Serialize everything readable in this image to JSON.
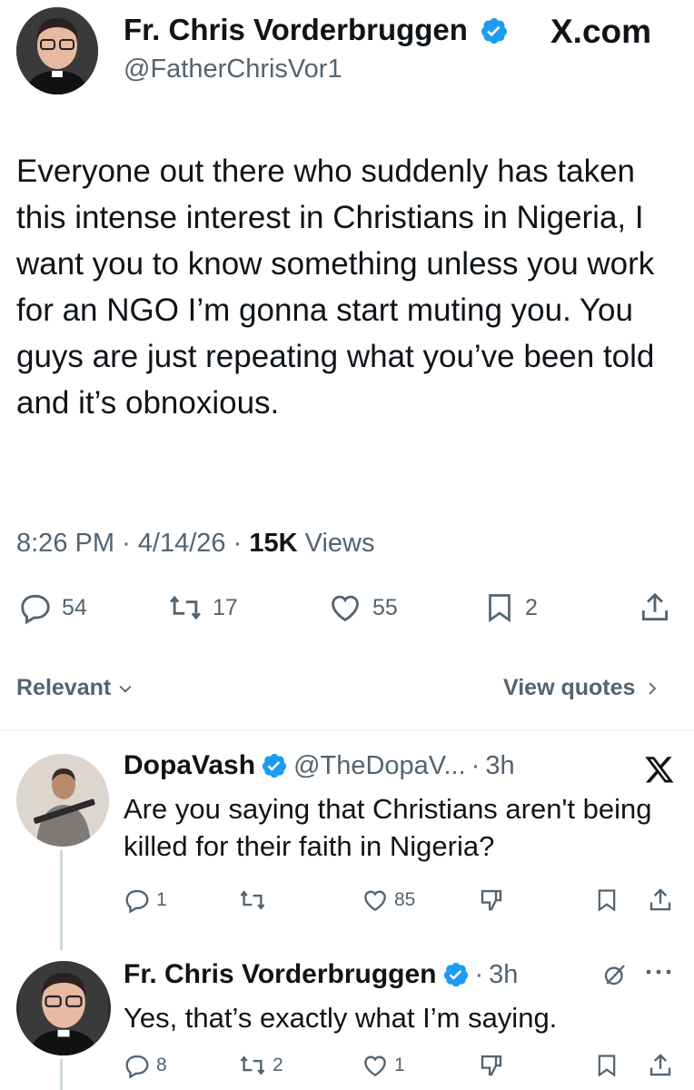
{
  "main_tweet": {
    "author_name": "Fr. Chris Vorderbruggen",
    "author_handle": "@FatherChrisVor1",
    "site_label": "X.com",
    "text": "Everyone out there who suddenly has taken this intense interest in Christians in Nigeria, I want you to know something unless you work for an NGO I’m gonna start muting you. You guys are just repeating what you’ve been told and it’s obnoxious.",
    "time": "8:26 PM",
    "date": "4/14/26",
    "views_count": "15K",
    "views_label": "Views",
    "separator": "·",
    "replies": "54",
    "reposts": "17",
    "likes": "55",
    "bookmarks": "2"
  },
  "filters": {
    "sort_label": "Relevant",
    "view_quotes_label": "View quotes"
  },
  "replies": [
    {
      "author_name": "DopaVash",
      "author_handle": "@TheDopaV...",
      "time": "3h",
      "text": "Are you saying that Christians aren't being killed for their faith in Nigeria?",
      "replies": "1",
      "reposts": "",
      "likes": "85"
    },
    {
      "author_name": "Fr. Chris Vorderbruggen",
      "time": "3h",
      "text": "Yes, that’s exactly what I’m saying.",
      "replies": "8",
      "reposts": "2",
      "likes": "1"
    }
  ],
  "colors": {
    "verified": "#1d9bf0",
    "text": "#0f1419",
    "secondary": "#536471",
    "divider": "#eff3f4"
  },
  "icons": [
    "verified-badge-icon",
    "x-logo-icon",
    "reply-icon",
    "repost-icon",
    "like-icon",
    "bookmark-icon",
    "share-icon",
    "chevron-down-icon",
    "chevron-right-icon",
    "dislike-icon",
    "grok-icon",
    "more-icon"
  ]
}
